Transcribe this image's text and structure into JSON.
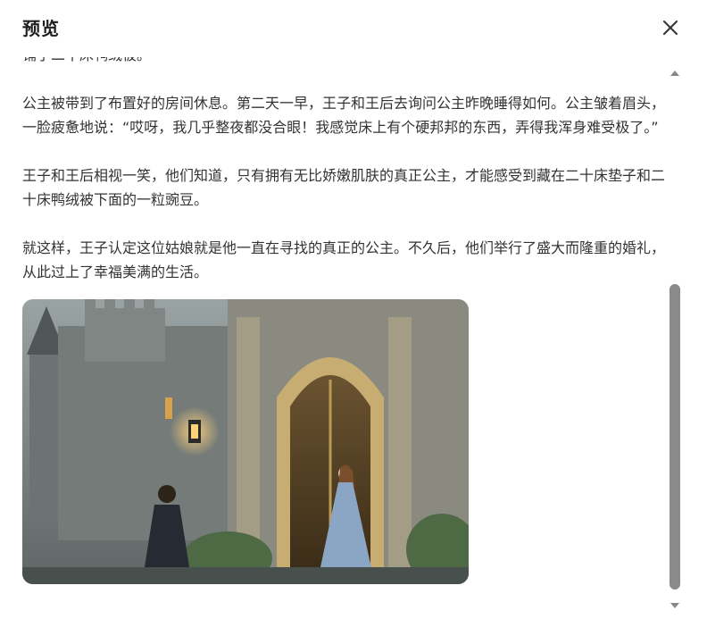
{
  "dialog": {
    "title": "预览",
    "close_icon": "close-icon"
  },
  "content": {
    "partial_line": "铺了二十床鸭绒被。",
    "paragraphs": [
      "公主被带到了布置好的房间休息。第二天一早，王子和王后去询问公主昨晚睡得如何。公主皱着眉头，一脸疲惫地说：“哎呀，我几乎整夜都没合眼！我感觉床上有个硬邦邦的东西，弄得我浑身难受极了。”",
      "王子和王后相视一笑，他们知道，只有拥有无比娇嫩肌肤的真正公主，才能感受到藏在二十床垫子和二十床鸭绒被下面的一粒豌豆。",
      "就这样，王子认定这位姑娘就是他一直在寻找的真正的公主。不久后，他们举行了盛大而隆重的婚礼，从此过上了幸福美满的生活。"
    ],
    "image_icon": "castle-prince-princess-illustration"
  },
  "scrollbar": {
    "position_fraction": 0.42
  },
  "colors": {
    "text": "#333333",
    "title": "#1f1f1f",
    "thumb": "#8a8a8a"
  }
}
